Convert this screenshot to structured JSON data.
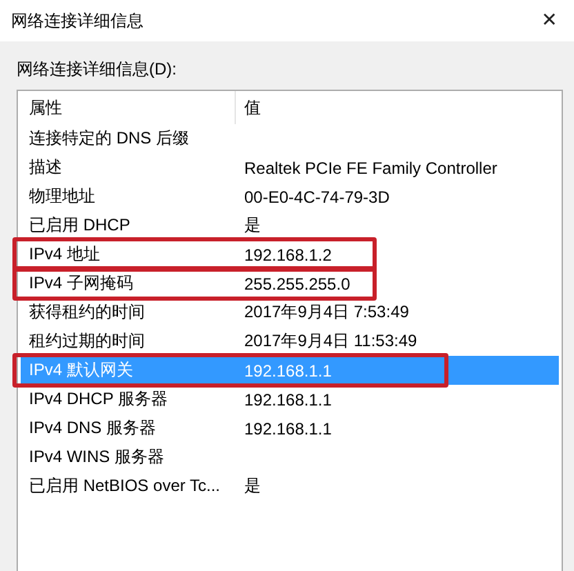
{
  "window": {
    "title": "网络连接详细信息",
    "close": "✕"
  },
  "list_label": "网络连接详细信息(D):",
  "columns": [
    "属性",
    "值"
  ],
  "rows": [
    {
      "property": "连接特定的 DNS 后缀",
      "value": "",
      "selected": false,
      "annotated": false
    },
    {
      "property": "描述",
      "value": "Realtek PCIe FE Family Controller",
      "selected": false,
      "annotated": false
    },
    {
      "property": "物理地址",
      "value": "00-E0-4C-74-79-3D",
      "selected": false,
      "annotated": false
    },
    {
      "property": "已启用 DHCP",
      "value": "是",
      "selected": false,
      "annotated": false
    },
    {
      "property": "IPv4 地址",
      "value": "192.168.1.2",
      "selected": false,
      "annotated": true
    },
    {
      "property": "IPv4 子网掩码",
      "value": "255.255.255.0",
      "selected": false,
      "annotated": true
    },
    {
      "property": "获得租约的时间",
      "value": "2017年9月4日 7:53:49",
      "selected": false,
      "annotated": false
    },
    {
      "property": "租约过期的时间",
      "value": "2017年9月4日 11:53:49",
      "selected": false,
      "annotated": false
    },
    {
      "property": "IPv4 默认网关",
      "value": "192.168.1.1",
      "selected": true,
      "annotated": true
    },
    {
      "property": "IPv4 DHCP 服务器",
      "value": "192.168.1.1",
      "selected": false,
      "annotated": false
    },
    {
      "property": "IPv4 DNS 服务器",
      "value": "192.168.1.1",
      "selected": false,
      "annotated": false
    },
    {
      "property": "IPv4 WINS 服务器",
      "value": "",
      "selected": false,
      "annotated": false
    },
    {
      "property": "已启用 NetBIOS over Tc...",
      "value": "是",
      "selected": false,
      "annotated": false
    }
  ]
}
